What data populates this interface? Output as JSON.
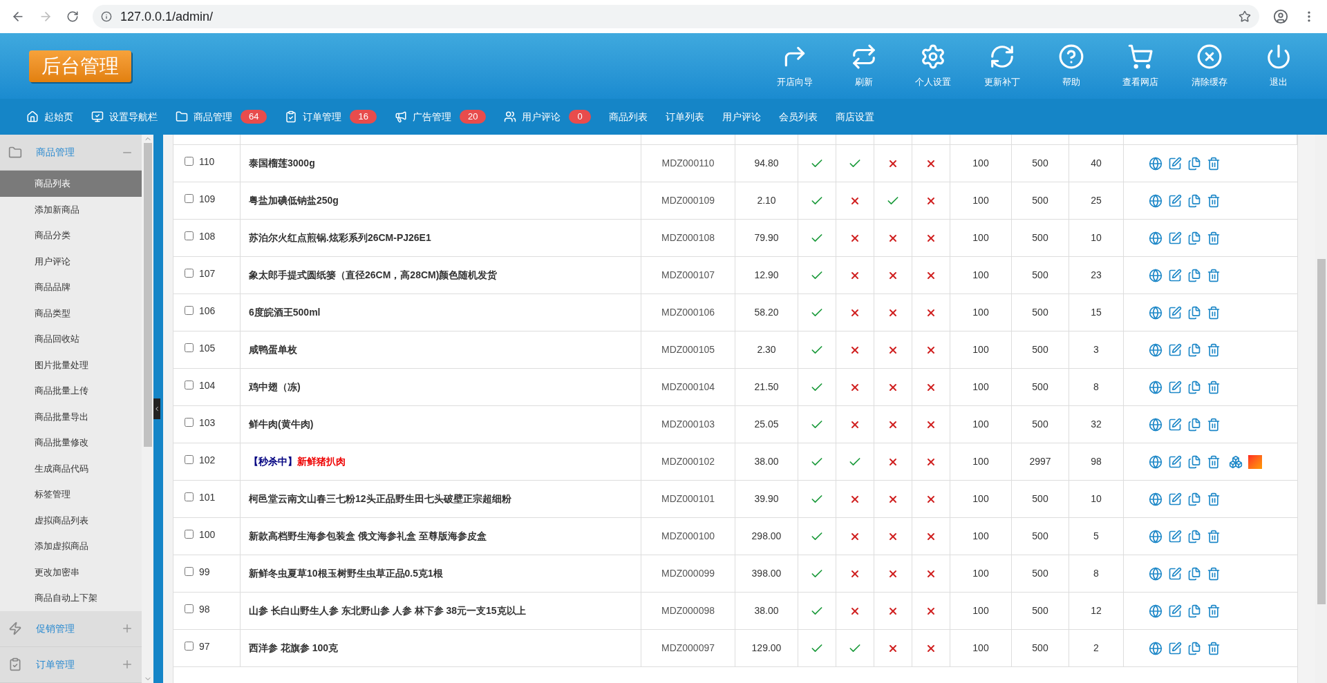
{
  "browser": {
    "url": "127.0.0.1/admin/"
  },
  "header": {
    "logo": "后台管理",
    "tools": [
      {
        "kind": "guide",
        "label": "开店向导"
      },
      {
        "kind": "refresh",
        "label": "刷新"
      },
      {
        "kind": "settings",
        "label": "个人设置"
      },
      {
        "kind": "update",
        "label": "更新补丁"
      },
      {
        "kind": "help",
        "label": "帮助"
      },
      {
        "kind": "shop",
        "label": "查看网店"
      },
      {
        "kind": "clear",
        "label": "清除缓存"
      },
      {
        "kind": "logout",
        "label": "退出"
      }
    ]
  },
  "nav": [
    {
      "kind": "home",
      "label": "起始页"
    },
    {
      "kind": "monitor",
      "label": "设置导航栏"
    },
    {
      "kind": "folder",
      "label": "商品管理",
      "badge": "64"
    },
    {
      "kind": "order",
      "label": "订单管理",
      "badge": "16"
    },
    {
      "kind": "ad",
      "label": "广告管理",
      "badge": "20"
    },
    {
      "kind": "users",
      "label": "用户评论",
      "badge": "0"
    },
    {
      "label": "商品列表"
    },
    {
      "label": "订单列表"
    },
    {
      "label": "用户评论"
    },
    {
      "label": "会员列表"
    },
    {
      "label": "商店设置"
    }
  ],
  "sidebar": [
    {
      "kind": "folder",
      "label": "商品管理",
      "expanded": true,
      "children": [
        {
          "label": "商品列表",
          "selected": true
        },
        {
          "label": "添加新商品",
          "selected": false
        },
        {
          "label": "商品分类",
          "selected": false
        },
        {
          "label": "用户评论",
          "selected": false
        },
        {
          "label": "商品品牌",
          "selected": false
        },
        {
          "label": "商品类型",
          "selected": false
        },
        {
          "label": "商品回收站",
          "selected": false
        },
        {
          "label": "图片批量处理",
          "selected": false
        },
        {
          "label": "商品批量上传",
          "selected": false
        },
        {
          "label": "商品批量导出",
          "selected": false
        },
        {
          "label": "商品批量修改",
          "selected": false
        },
        {
          "label": "生成商品代码",
          "selected": false
        },
        {
          "label": "标签管理",
          "selected": false
        },
        {
          "label": "虚拟商品列表",
          "selected": false
        },
        {
          "label": "添加虚拟商品",
          "selected": false
        },
        {
          "label": "更改加密串",
          "selected": false
        },
        {
          "label": "商品自动上下架",
          "selected": false
        }
      ]
    },
    {
      "kind": "bolt",
      "label": "促销管理",
      "expanded": false
    },
    {
      "kind": "order",
      "label": "订单管理",
      "expanded": false
    }
  ],
  "table": {
    "rows": [
      {
        "id": "110",
        "checked": false,
        "name": "泰国榴莲3000g",
        "sn": "MDZ000110",
        "price": "94.80",
        "flags": [
          true,
          true,
          false,
          false
        ],
        "column_9": "100",
        "column_10": "500",
        "column_11": "40"
      },
      {
        "id": "109",
        "checked": false,
        "name": "粤盐加碘低钠盐250g",
        "sn": "MDZ000109",
        "price": "2.10",
        "flags": [
          true,
          false,
          true,
          false
        ],
        "column_9": "100",
        "column_10": "500",
        "column_11": "25"
      },
      {
        "id": "108",
        "checked": false,
        "name": "苏泊尔火红点煎锅.炫彩系列26CM-PJ26E1",
        "sn": "MDZ000108",
        "price": "79.90",
        "flags": [
          true,
          false,
          false,
          false
        ],
        "column_9": "100",
        "column_10": "500",
        "column_11": "10"
      },
      {
        "id": "107",
        "checked": false,
        "name": "象太郎手提式圆纸篓（直径26CM，高28CM)颜色随机发货",
        "sn": "MDZ000107",
        "price": "12.90",
        "flags": [
          true,
          false,
          false,
          false
        ],
        "column_9": "100",
        "column_10": "500",
        "column_11": "23"
      },
      {
        "id": "106",
        "checked": false,
        "name": "6度皖酒王500ml",
        "sn": "MDZ000106",
        "price": "58.20",
        "flags": [
          true,
          false,
          false,
          false
        ],
        "column_9": "100",
        "column_10": "500",
        "column_11": "15"
      },
      {
        "id": "105",
        "checked": false,
        "name": "咸鸭蛋单枚",
        "sn": "MDZ000105",
        "price": "2.30",
        "flags": [
          true,
          false,
          false,
          false
        ],
        "column_9": "100",
        "column_10": "500",
        "column_11": "3"
      },
      {
        "id": "104",
        "checked": false,
        "name": "鸡中翅（冻)",
        "sn": "MDZ000104",
        "price": "21.50",
        "flags": [
          true,
          false,
          false,
          false
        ],
        "column_9": "100",
        "column_10": "500",
        "column_11": "8"
      },
      {
        "id": "103",
        "checked": false,
        "name": "鲜牛肉(黄牛肉)",
        "sn": "MDZ000103",
        "price": "25.05",
        "flags": [
          true,
          false,
          false,
          false
        ],
        "column_9": "100",
        "column_10": "500",
        "column_11": "32"
      },
      {
        "id": "102",
        "checked": false,
        "promo": "【秒杀中】",
        "name": "新鲜猪扒肉",
        "sn": "MDZ000102",
        "price": "38.00",
        "flags": [
          true,
          true,
          false,
          false
        ],
        "column_9": "100",
        "column_10": "2997",
        "column_11": "98",
        "extra_actions": true
      },
      {
        "id": "101",
        "checked": false,
        "name": "柯邑堂云南文山春三七粉12头正品野生田七头破壁正宗超细粉",
        "sn": "MDZ000101",
        "price": "39.90",
        "flags": [
          true,
          false,
          false,
          false
        ],
        "column_9": "100",
        "column_10": "500",
        "column_11": "10"
      },
      {
        "id": "100",
        "checked": false,
        "name": "新款高档野生海参包装盒 俄文海参礼盒 至尊版海参皮盒",
        "sn": "MDZ000100",
        "price": "298.00",
        "flags": [
          true,
          false,
          false,
          false
        ],
        "column_9": "100",
        "column_10": "500",
        "column_11": "5"
      },
      {
        "id": "99",
        "checked": false,
        "name": "新鲜冬虫夏草10根玉树野生虫草正品0.5克1根",
        "sn": "MDZ000099",
        "price": "398.00",
        "flags": [
          true,
          false,
          false,
          false
        ],
        "column_9": "100",
        "column_10": "500",
        "column_11": "8"
      },
      {
        "id": "98",
        "checked": false,
        "name": "山参 长白山野生人参 东北野山参 人参 林下参 38元一支15克以上",
        "sn": "MDZ000098",
        "price": "38.00",
        "flags": [
          true,
          false,
          false,
          false
        ],
        "column_9": "100",
        "column_10": "500",
        "column_11": "12"
      },
      {
        "id": "97",
        "checked": false,
        "name": "西洋参 花旗参 100克",
        "sn": "MDZ000097",
        "price": "129.00",
        "flags": [
          true,
          true,
          false,
          false
        ],
        "column_9": "100",
        "column_10": "500",
        "column_11": "2"
      }
    ]
  }
}
